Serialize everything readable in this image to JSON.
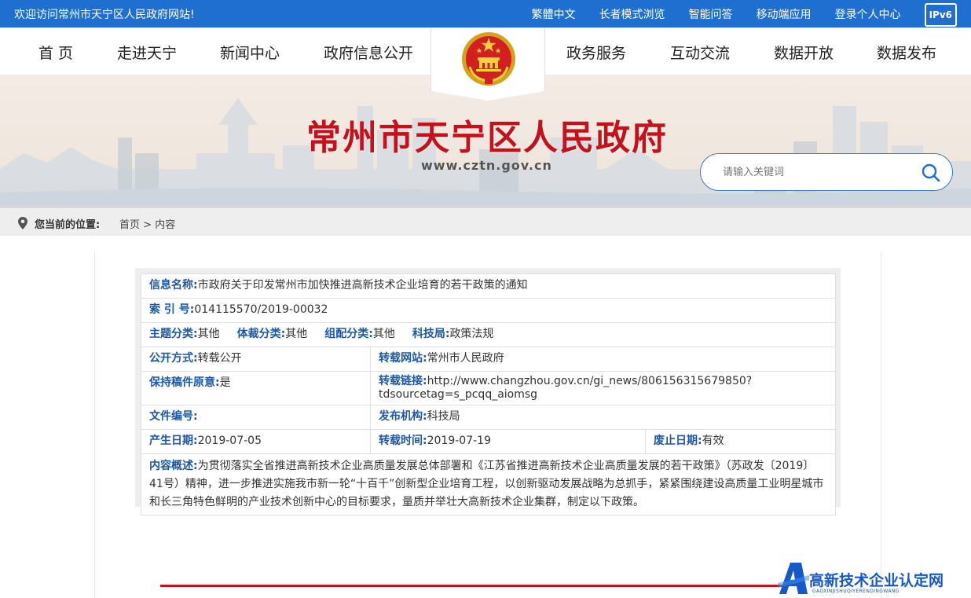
{
  "topbar": {
    "welcome": "欢迎访问常州市天宁区人民政府网站!",
    "links": [
      "繁體中文",
      "长者模式浏览",
      "智能问答",
      "移动端应用",
      "登录个人中心"
    ],
    "ipv6": "IPv6"
  },
  "nav": {
    "items": [
      "首 页",
      "走进天宁",
      "新闻中心",
      "政府信息公开",
      "政务服务",
      "互动交流",
      "数据开放",
      "数据发布"
    ]
  },
  "banner": {
    "title": "常州市天宁区人民政府",
    "url": "www.cztn.gov.cn",
    "search_placeholder": "请输入关键词"
  },
  "breadcrumb": {
    "label": "您当前的位置:",
    "home": "首页",
    "separator": ">",
    "current": "内容"
  },
  "info": {
    "name_label": "信息名称:",
    "name_value": "市政府关于印发常州市加快推进高新技术企业培育的若干政策的通知",
    "index_label": "索 引 号:",
    "index_value": "014115570/2019-00032",
    "topic_label": "主题分类:",
    "topic_value": "其他",
    "genre_label": "体裁分类:",
    "genre_value": "其他",
    "org_label": "组配分类:",
    "org_value": "其他",
    "bureau_label": "科技局:",
    "bureau_value": "政策法规",
    "open_label": "公开方式:",
    "open_value": "转载公开",
    "repost_site_label": "转载网站:",
    "repost_site_value": "常州市人民政府",
    "keep_label": "保持稿件原意:",
    "keep_value": "是",
    "repost_link_label": "转载链接:",
    "repost_link_value_1": "http://www.changzhou.gov.cn/gi_news/806156315679850?",
    "repost_link_value_2": "tdsourcetag=s_pcqq_aiomsg",
    "doc_no_label": "文件编号:",
    "doc_no_value": "",
    "publisher_label": "发布机构:",
    "publisher_value": "科技局",
    "created_label": "产生日期:",
    "created_value": "2019-07-05",
    "repost_time_label": "转载时间:",
    "repost_time_value": "2019-07-19",
    "abolish_label": "废止日期:",
    "abolish_value": "有效",
    "summary_label": "内容概述:",
    "summary_value": "为贯彻落实全省推进高新技术企业高质量发展总体部署和《江苏省推进高新技术企业高质量发展的若干政策》（苏政发〔2019〕41号）精神，进一步推进实施我市新一轮“十百千”创新型企业培育工程，以创新驱动发展战略为总抓手，紧紧围绕建设高质量工业明星城市和长三角特色鲜明的产业技术创新中心的目标要求，量质并举壮大高新技术企业集群，制定以下政策。"
  },
  "watermark": {
    "text": "高新技术企业认定网",
    "sub": "GAOXINJISHUQIYERENDINGWANG"
  },
  "colors": {
    "topbar": "#1e6fd0",
    "title_red": "#c8101a",
    "label_blue": "#1d57a5"
  }
}
